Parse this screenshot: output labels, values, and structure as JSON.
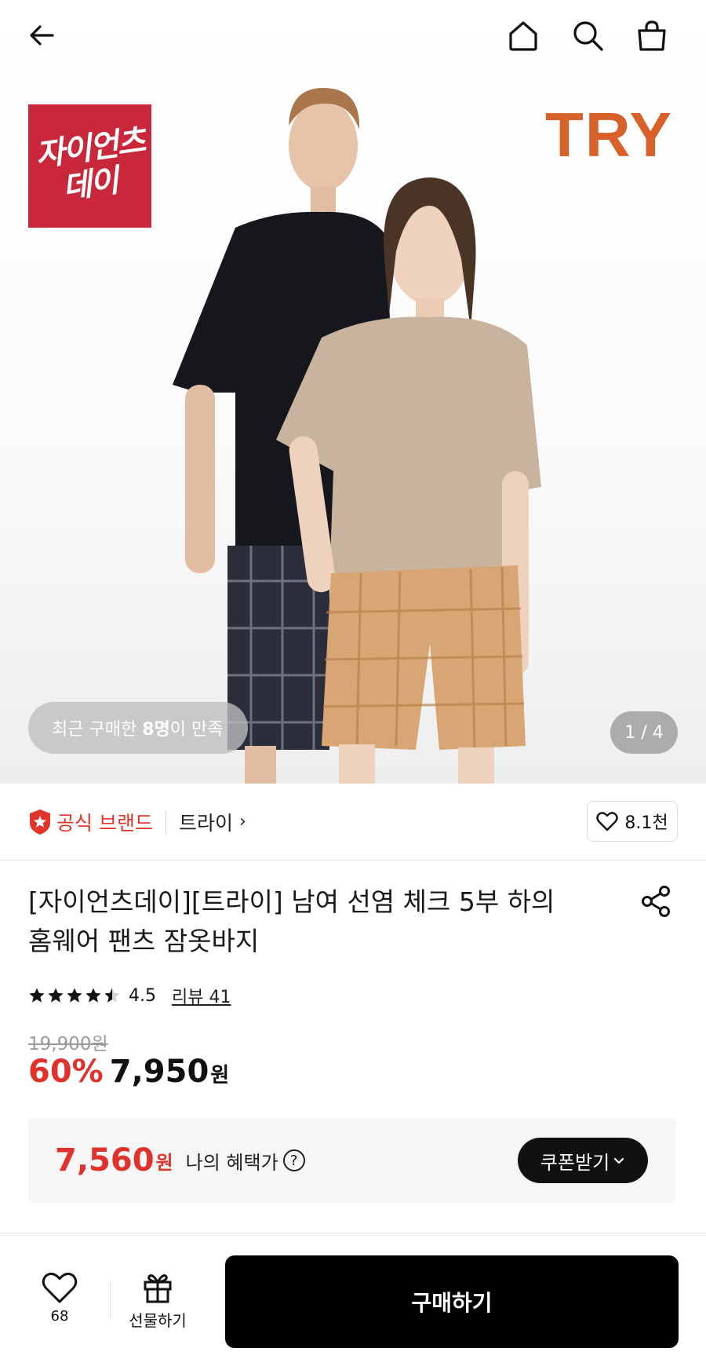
{
  "header": {
    "back_icon": "arrow-left-icon",
    "home_icon": "home-icon",
    "search_icon": "search-icon",
    "cart_icon": "shopping-bag-icon"
  },
  "hero": {
    "event_badge_lines": [
      "자이언츠",
      "데이"
    ],
    "brand_logo": "TRY",
    "satisfaction": {
      "prefix": "최근 구매한 ",
      "count": "8명",
      "suffix": "이 만족"
    },
    "pager": "1 / 4"
  },
  "brand": {
    "official_label": "공식 브랜드",
    "name": "트라이",
    "likes": "8.1천"
  },
  "product": {
    "title_line1": "[자이언츠데이][트라이] 남여 선염 체크 5부 하의",
    "title_line2": "홈웨어 팬츠 잠옷바지",
    "rating": "4.5",
    "rating_value": 4.5,
    "review_label": "리뷰 41",
    "original_price": "19,900원",
    "discount": "60%",
    "price": "7,950",
    "currency": "원"
  },
  "benefit": {
    "price": "7,560",
    "currency": "원",
    "label": "나의 혜택가",
    "help": "?",
    "coupon_button": "쿠폰받기"
  },
  "bottom_bar": {
    "wish_count": "68",
    "gift_label": "선물하기",
    "buy_label": "구매하기"
  },
  "colors": {
    "accent_red": "#e0322c",
    "badge_red": "#c8283a",
    "brand_orange": "#d8612a",
    "black": "#000000"
  }
}
